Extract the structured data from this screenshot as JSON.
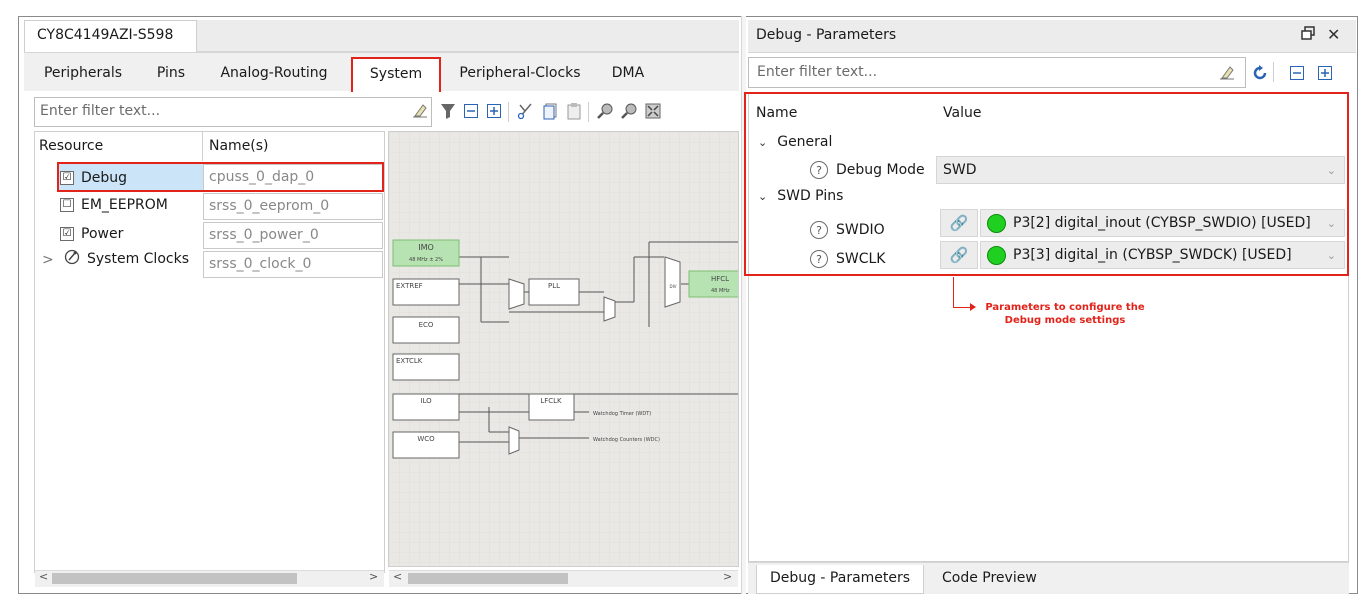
{
  "left": {
    "doc_tab": "CY8C4149AZI-S598",
    "tabs": [
      "Peripherals",
      "Pins",
      "Analog-Routing",
      "System",
      "Peripheral-Clocks",
      "DMA"
    ],
    "filter_placeholder": "Enter filter text...",
    "columns": {
      "resource": "Resource",
      "names": "Name(s)"
    },
    "rows": [
      {
        "label": "Debug",
        "name": "cpuss_0_dap_0",
        "checked": "☑"
      },
      {
        "label": "EM_EEPROM",
        "name": "srss_0_eeprom_0",
        "checked": "☐"
      },
      {
        "label": "Power",
        "name": "srss_0_power_0",
        "checked": "☑"
      },
      {
        "label": "System Clocks",
        "name": "srss_0_clock_0",
        "expander": ">"
      }
    ],
    "diagram": {
      "imo": "IMO",
      "imo_freq": "48 MHz ± 2%",
      "extref": "EXTREF",
      "pll": "PLL",
      "eco": "ECO",
      "hfclk": "HFCL",
      "hfclk_freq": "48 MHz",
      "extclk": "EXTCLK",
      "ilo": "ILO",
      "lfclk": "LFCLK",
      "wco": "WCO",
      "wdt": "Watchdog Timer (WDT)",
      "wdc": "Watchdog Counters (WDC)",
      "mux_label": "DIV"
    }
  },
  "right": {
    "title": "Debug - Parameters",
    "filter_placeholder": "Enter filter text...",
    "columns": {
      "name": "Name",
      "value": "Value"
    },
    "general": "General",
    "debug_mode_label": "Debug Mode",
    "debug_mode_value": "SWD",
    "swd_pins": "SWD Pins",
    "swdio_label": "SWDIO",
    "swdio_value": "P3[2] digital_inout (CYBSP_SWDIO) [USED]",
    "swclk_label": "SWCLK",
    "swclk_value": "P3[3] digital_in (CYBSP_SWDCK) [USED]",
    "annotation_line1": "Parameters to configure the",
    "annotation_line2": "Debug mode settings",
    "bottom_tabs": [
      "Debug - Parameters",
      "Code Preview"
    ]
  },
  "icons": {
    "eraser": "eraser-icon",
    "filter": "filter-icon",
    "collapse": "collapse-all-icon",
    "expand": "expand-all-icon",
    "cut": "cut-icon",
    "copy": "copy-icon",
    "paste": "paste-icon",
    "zoom_in": "zoom-in-icon",
    "zoom_out": "zoom-out-icon",
    "fit": "zoom-fit-icon",
    "refresh": "refresh-icon",
    "link": "link-icon",
    "float": "float-window-icon",
    "close": "close-icon"
  },
  "colors": {
    "highlight": "#e2231a",
    "selection": "#cce4f7",
    "status_ok": "#20d020"
  }
}
